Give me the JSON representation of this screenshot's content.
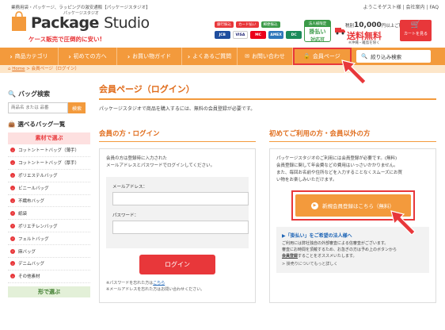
{
  "header": {
    "tagline": "業務用袋・パッケージ、ラッピングの激安通販【パッケージスタジオ】",
    "links": [
      "ようこそゲスト様",
      "会社案内",
      "FAQ"
    ],
    "logo_sub": "パッケージスタジオ",
    "logo_main": "Package",
    "logo_studio": "Studio",
    "slogan": "ケース販売で圧倒的に安い!",
    "payment_labels": [
      "銀行振込",
      "カード払い",
      "郵便振込"
    ],
    "cards": [
      "JCB",
      "VISA",
      "MC",
      "AMEX",
      "DC"
    ],
    "sameday": {
      "top": "法人様限定",
      "mid": "掛払い",
      "bottom": "対応可"
    },
    "freeship": {
      "line1_prefix": "税別",
      "line1_amount": "10,000",
      "line1_suffix": "円以上ご購入で",
      "line2": "送料無料",
      "line3": "※沖縄・離島を除く"
    },
    "cart_label": "カートを見る"
  },
  "nav": {
    "items": [
      {
        "label": "商品カテゴリ"
      },
      {
        "label": "初めての方へ"
      },
      {
        "label": "お買い物ガイド"
      },
      {
        "label": "よくあるご質問"
      },
      {
        "label": "お問い合わせ"
      },
      {
        "label": "会員ページ"
      }
    ],
    "search_label": "絞り込み検索"
  },
  "breadcrumb": {
    "home": "Home",
    "sep": ">",
    "current": "会員ページ（ログイン）"
  },
  "sidebar": {
    "search_title": "バッグ検索",
    "search_placeholder": "商品名 または 品番",
    "search_button": "検索",
    "category_title": "選べるバッグ一覧",
    "material_head": "素材で選ぶ",
    "items": [
      "コットントートバッグ（薄手）",
      "コットントートバッグ（厚手）",
      "ポリエステルバッグ",
      "ビニールバッグ",
      "不織布バッグ",
      "紙袋",
      "ポリエチレンバッグ",
      "フェルトバッグ",
      "麻バッグ",
      "デニムバッグ",
      "その他素材"
    ],
    "shape_head": "形で選ぶ"
  },
  "main": {
    "title": "会員ページ（ログイン）",
    "intro": "パッケージスタジオで商品を購入するには、無料の会員登録が必要です。",
    "left": {
      "title": "会員の方・ログイン",
      "desc1": "会員の方は登録時に入力された",
      "desc2": "メールアドレスとパスワードでログインしてください。",
      "email_label": "メールアドレス：",
      "password_label": "パスワード：",
      "login_button": "ログイン",
      "note1_prefix": "※パスワードを忘れた方は",
      "note1_link": "こちら",
      "note2": "※メールアドレスを忘れた方はお問い合わせください。"
    },
    "right": {
      "title": "初めてご利用の方・会員以外の方",
      "desc1": "パッケージスタジオのご利用には会員登録が必要です。(無料)",
      "desc2": "会員登録に関して年会費などの費用はいっさいかかりません。",
      "desc3": "また、毎回お名前や住所などを入力することなくスムーズにお買",
      "desc4": "い物をお楽しみいただけます。",
      "register_button": "新規会員登録はこちら（無料）",
      "deferred_title": "▶「掛払い」をご希望の法人様へ",
      "deferred_text1": "ご利用には弊社独自の外部審査による信審査がございます。",
      "deferred_text2": "審査にお時間を頂戴するため、お急ぎの方は予め上のボタンから",
      "deferred_text3_bold": "会員登録",
      "deferred_text3_rest": "することをオススメいたします。",
      "deferred_link": "> 掛売りについてもっと詳しく"
    }
  },
  "colors": {
    "orange": "#f39a3c",
    "red": "#e8373a",
    "green": "#3b9a48",
    "link": "#1b63b5"
  }
}
